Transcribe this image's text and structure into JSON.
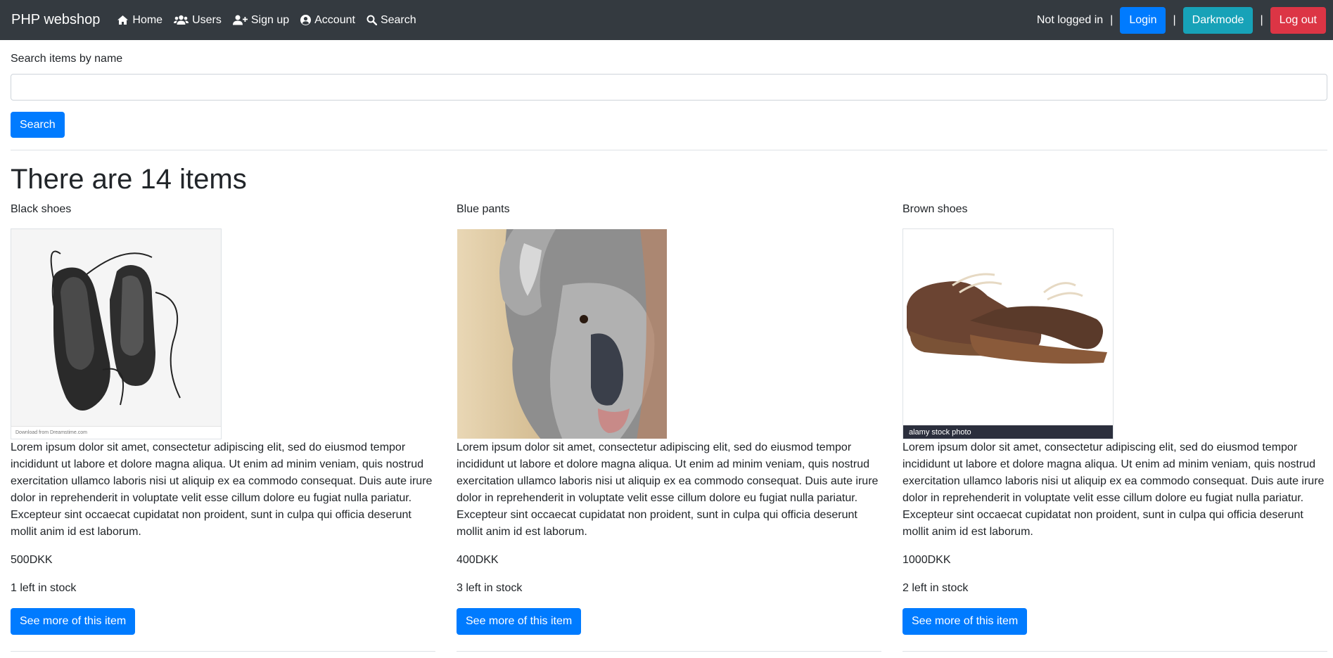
{
  "navbar": {
    "brand": "PHP webshop",
    "links": [
      {
        "label": "Home",
        "icon": "home-icon"
      },
      {
        "label": "Users",
        "icon": "users-icon"
      },
      {
        "label": "Sign up",
        "icon": "user-plus-icon"
      },
      {
        "label": "Account",
        "icon": "user-circle-icon"
      },
      {
        "label": "Search",
        "icon": "search-icon"
      }
    ],
    "status": "Not logged in",
    "separator": "|",
    "login_label": "Login",
    "darkmode_label": "Darkmode",
    "logout_label": "Log out"
  },
  "search": {
    "label": "Search items by name",
    "value": "",
    "button_label": "Search"
  },
  "heading": "There are 14 items",
  "items": [
    {
      "name": "Black shoes",
      "description": "Lorem ipsum dolor sit amet, consectetur adipiscing elit, sed do eiusmod tempor incididunt ut labore et dolore magna aliqua. Ut enim ad minim veniam, quis nostrud exercitation ullamco laboris nisi ut aliquip ex ea commodo consequat. Duis aute irure dolor in reprehenderit in voluptate velit esse cillum dolore eu fugiat nulla pariatur. Excepteur sint occaecat cupidatat non proident, sunt in culpa qui officia deserunt mollit anim id est laborum.",
      "price": "500DKK",
      "stock": "1 left in stock",
      "button_label": "See more of this item",
      "image_watermark": "Download from Dreamstime.com"
    },
    {
      "name": "Blue pants",
      "description": "Lorem ipsum dolor sit amet, consectetur adipiscing elit, sed do eiusmod tempor incididunt ut labore et dolore magna aliqua. Ut enim ad minim veniam, quis nostrud exercitation ullamco laboris nisi ut aliquip ex ea commodo consequat. Duis aute irure dolor in reprehenderit in voluptate velit esse cillum dolore eu fugiat nulla pariatur. Excepteur sint occaecat cupidatat non proident, sunt in culpa qui officia deserunt mollit anim id est laborum.",
      "price": "400DKK",
      "stock": "3 left in stock",
      "button_label": "See more of this item"
    },
    {
      "name": "Brown shoes",
      "description": "Lorem ipsum dolor sit amet, consectetur adipiscing elit, sed do eiusmod tempor incididunt ut labore et dolore magna aliqua. Ut enim ad minim veniam, quis nostrud exercitation ullamco laboris nisi ut aliquip ex ea commodo consequat. Duis aute irure dolor in reprehenderit in voluptate velit esse cillum dolore eu fugiat nulla pariatur. Excepteur sint occaecat cupidatat non proident, sunt in culpa qui officia deserunt mollit anim id est laborum.",
      "price": "1000DKK",
      "stock": "2 left in stock",
      "button_label": "See more of this item",
      "image_watermark": "alamy stock photo"
    }
  ],
  "colors": {
    "navbar_bg": "#343a40",
    "primary": "#007bff",
    "info": "#17a2b8",
    "danger": "#dc3545"
  }
}
